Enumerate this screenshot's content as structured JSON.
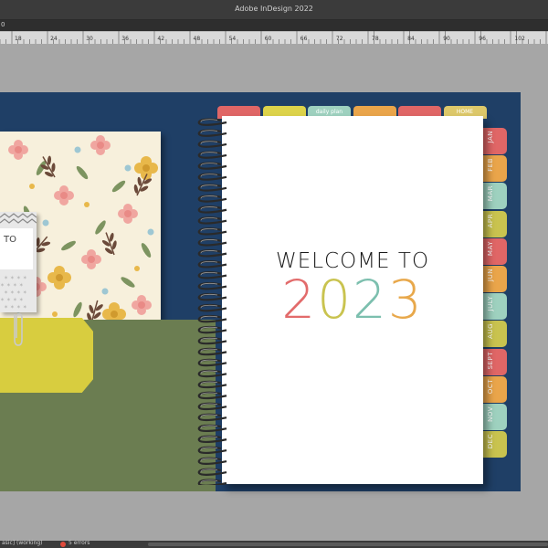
{
  "window": {
    "title": "Adobe InDesign 2022"
  },
  "ruler": {
    "corner_label": "0",
    "ticks": [
      "18",
      "24",
      "30",
      "36",
      "42",
      "48",
      "54",
      "60",
      "66",
      "72",
      "78",
      "84",
      "90",
      "96",
      "102"
    ]
  },
  "left_page": {
    "tag_text": "TO"
  },
  "notebook": {
    "welcome_text": "WELCOME TO",
    "year_digits": [
      "2",
      "0",
      "2",
      "3"
    ],
    "year_colors": [
      "#e26b6b",
      "#c9c34f",
      "#7cbfae",
      "#e8a84b"
    ]
  },
  "top_tabs": [
    {
      "label": "",
      "color": "#e06666"
    },
    {
      "label": "",
      "color": "#ddd34a"
    },
    {
      "label": "daily plan",
      "color": "#9ed1bf"
    },
    {
      "label": "",
      "color": "#eaa54a"
    },
    {
      "label": "",
      "color": "#e06666"
    },
    {
      "label": "HOME",
      "color": "#ddc86a"
    }
  ],
  "side_tabs": [
    {
      "label": "JAN",
      "color": "#e06666"
    },
    {
      "label": "FEB",
      "color": "#eaa54a"
    },
    {
      "label": "MAR",
      "color": "#9ed1bf"
    },
    {
      "label": "APR",
      "color": "#c9c34f"
    },
    {
      "label": "MAY",
      "color": "#e06666"
    },
    {
      "label": "JUN",
      "color": "#eaa54a"
    },
    {
      "label": "JULY",
      "color": "#9ed1bf"
    },
    {
      "label": "AUG",
      "color": "#c9c34f"
    },
    {
      "label": "SEPT",
      "color": "#e06666"
    },
    {
      "label": "OCT",
      "color": "#eaa54a"
    },
    {
      "label": "NOV",
      "color": "#9ed1bf"
    },
    {
      "label": "DEC",
      "color": "#c9c34f"
    }
  ],
  "status": {
    "prefix": "asic] (working)",
    "errors": "5 errors"
  }
}
